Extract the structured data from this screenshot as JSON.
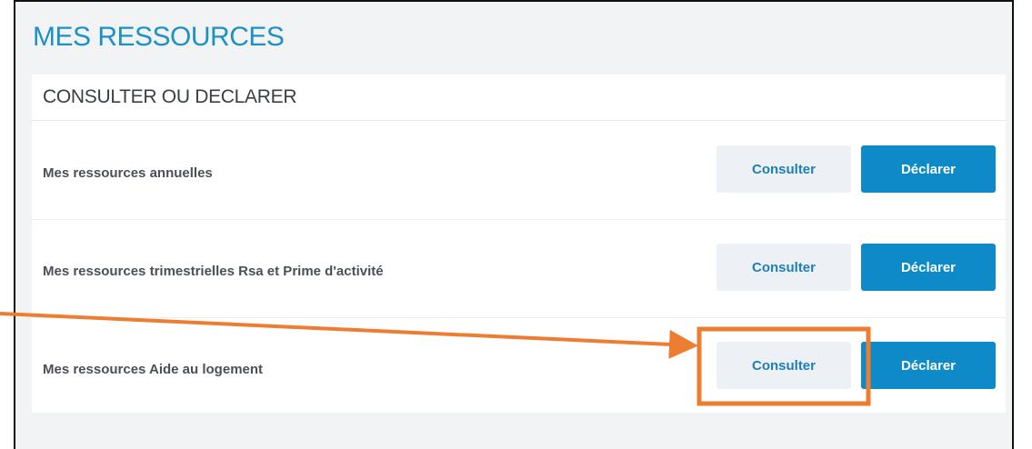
{
  "page": {
    "title": "MES RESSOURCES"
  },
  "card": {
    "title": "CONSULTER OU DECLARER",
    "rows": [
      {
        "label": "Mes ressources annuelles",
        "consult_label": "Consulter",
        "declare_label": "Déclarer"
      },
      {
        "label": "Mes ressources trimestrielles Rsa et Prime d'activité",
        "consult_label": "Consulter",
        "declare_label": "Déclarer"
      },
      {
        "label": "Mes ressources Aide au logement",
        "consult_label": "Consulter",
        "declare_label": "Déclarer"
      }
    ]
  },
  "annotation": {
    "color": "#ed7d31"
  },
  "colors": {
    "accent": "#0d8ac7",
    "title": "#1d91c6",
    "consult_bg": "#edf1f6"
  }
}
